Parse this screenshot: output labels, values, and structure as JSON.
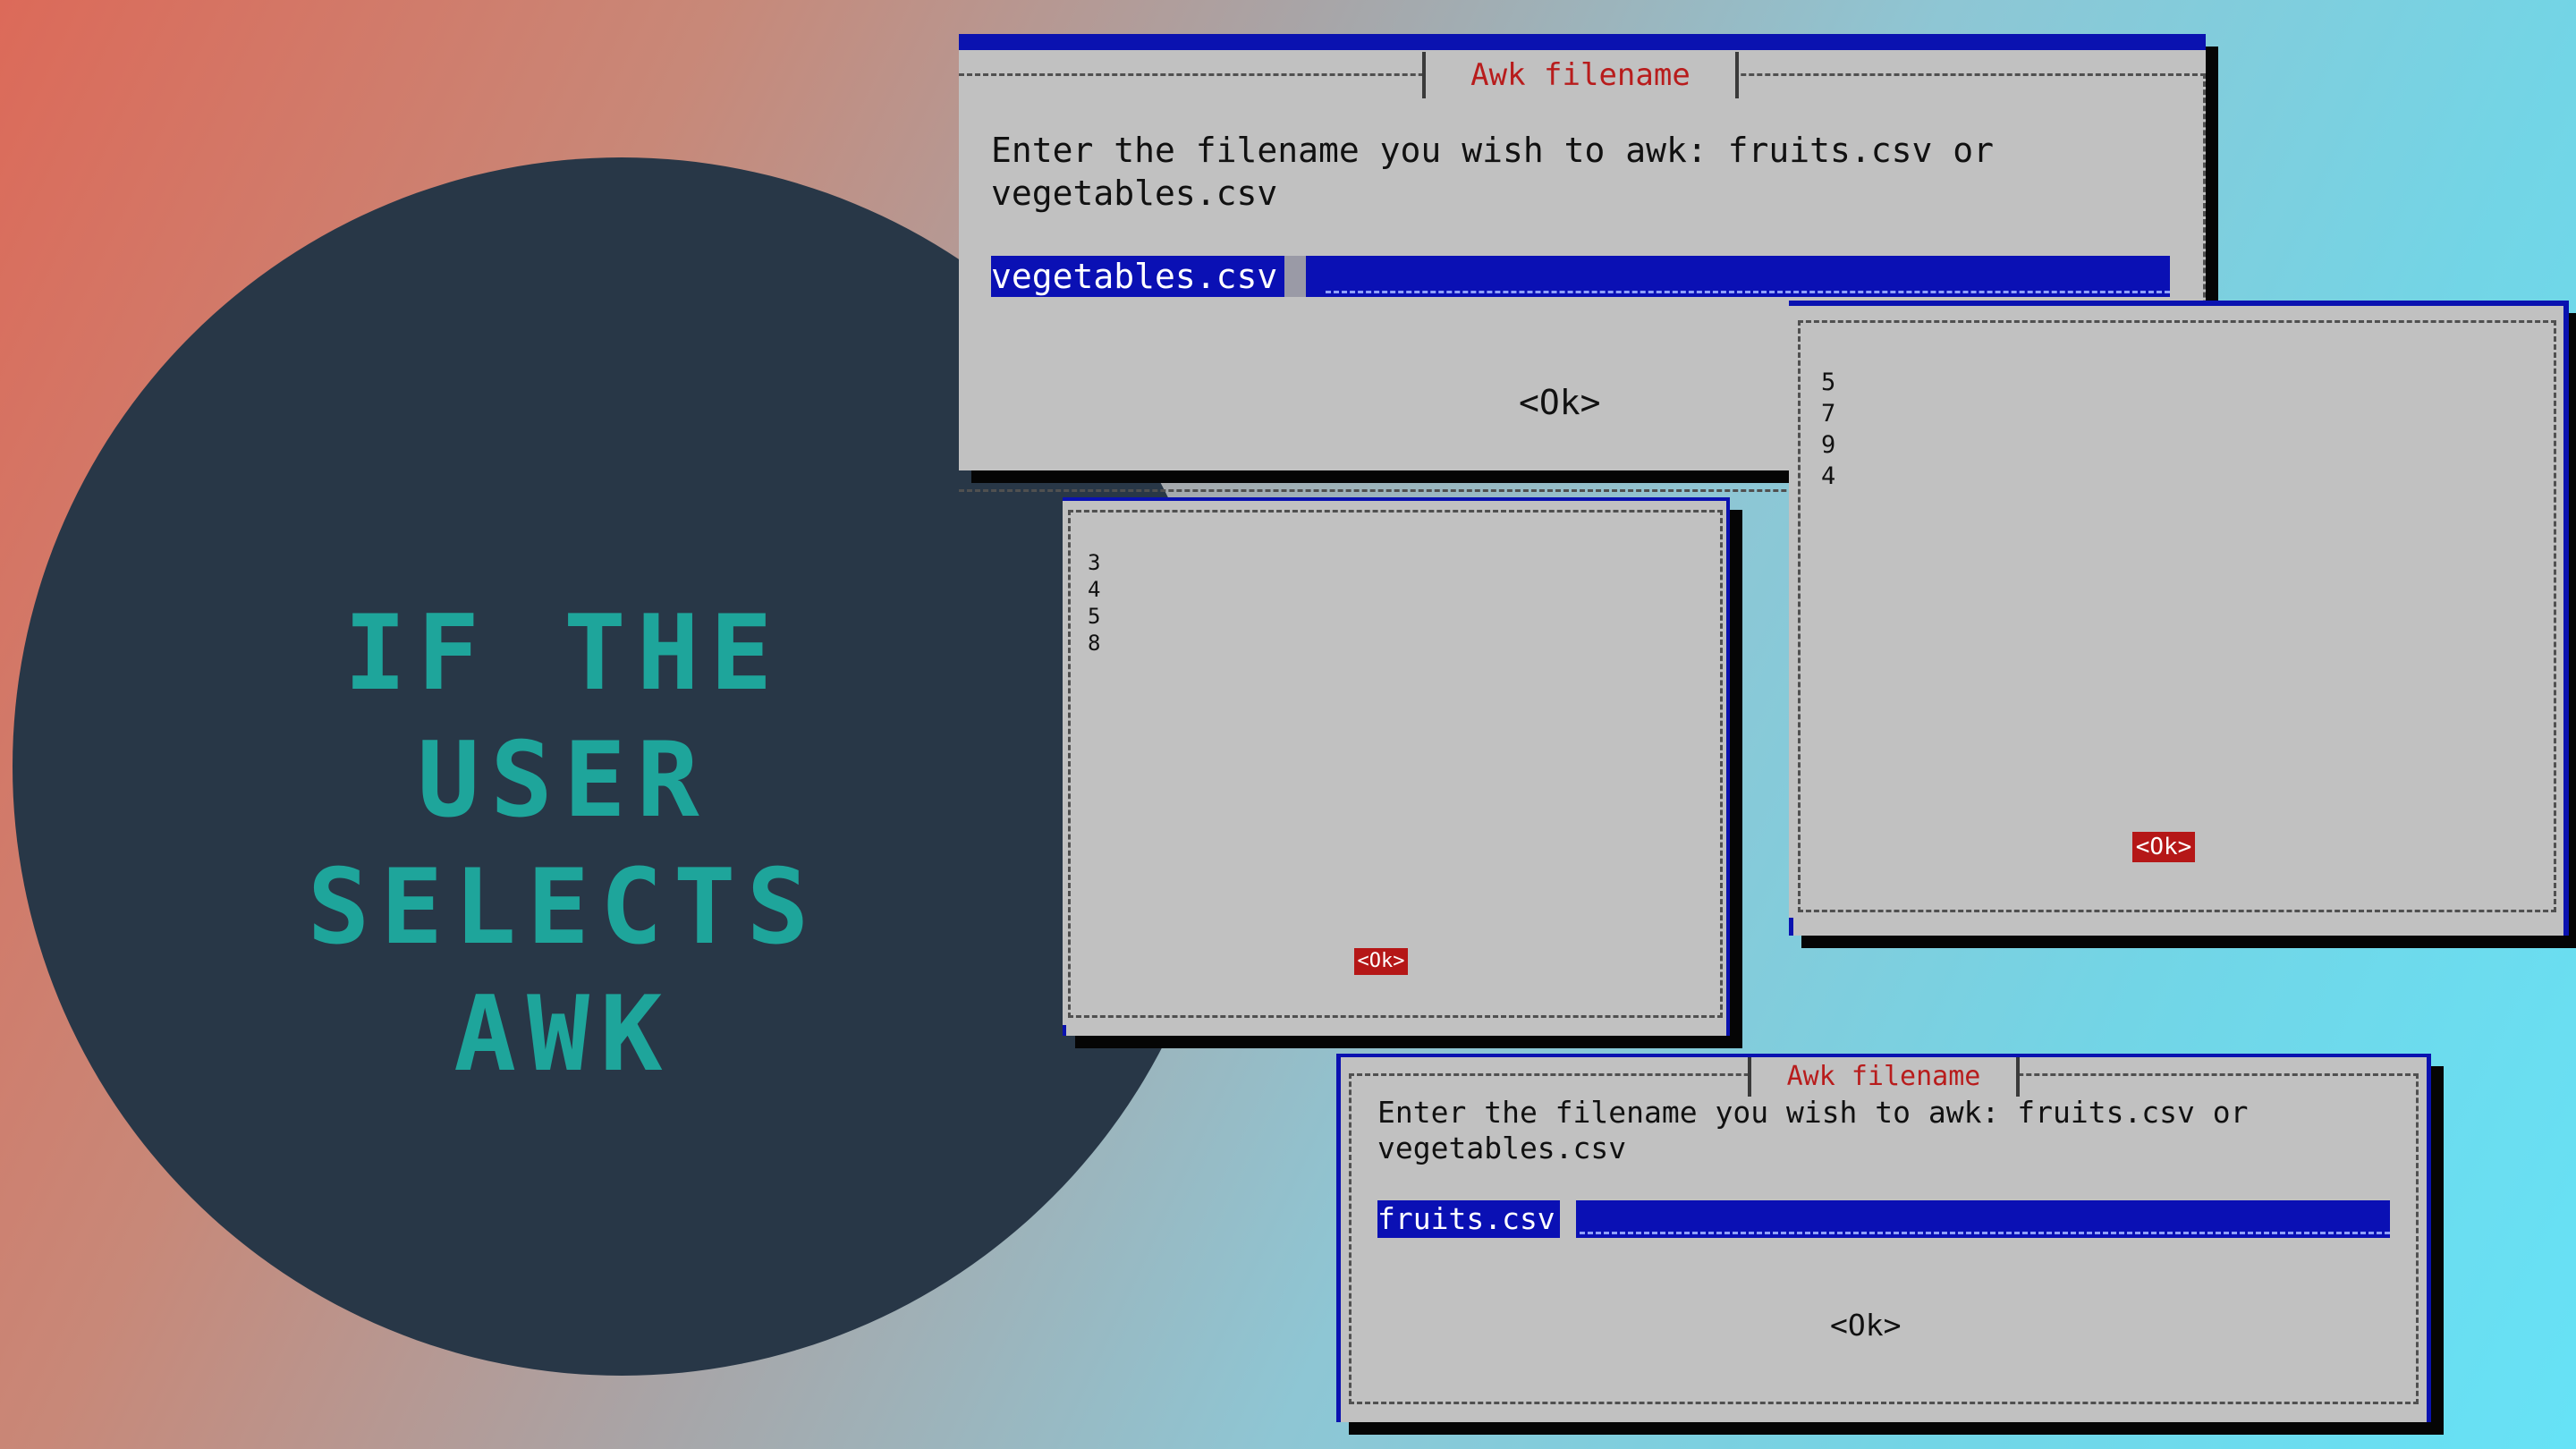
{
  "headline": {
    "line1": "IF THE USER",
    "line2": "SELECTS AWK"
  },
  "dialog_vegetables": {
    "title": "Awk filename",
    "prompt_line1": "Enter the filename you wish to awk: fruits.csv or",
    "prompt_line2": "vegetables.csv",
    "input_value": "vegetables.csv",
    "ok_label": "<Ok>"
  },
  "result_right": {
    "values": [
      "5",
      "7",
      "9",
      "4"
    ],
    "ok_label": "<Ok>"
  },
  "result_left": {
    "values": [
      "3",
      "4",
      "5",
      "8"
    ],
    "ok_label": "<Ok>"
  },
  "dialog_fruits": {
    "title": "Awk filename",
    "prompt_line1": "Enter the filename you wish to awk: fruits.csv or",
    "prompt_line2": "vegetables.csv",
    "input_value": "fruits.csv",
    "ok_label": "<Ok>"
  },
  "colors": {
    "circle": "#283747",
    "headline": "#1ea59b",
    "dialog_bg": "#c1c1c1",
    "dialog_title": "#b81c1c",
    "input_bg": "#0a10b4",
    "ok_highlight": "#b51717"
  }
}
